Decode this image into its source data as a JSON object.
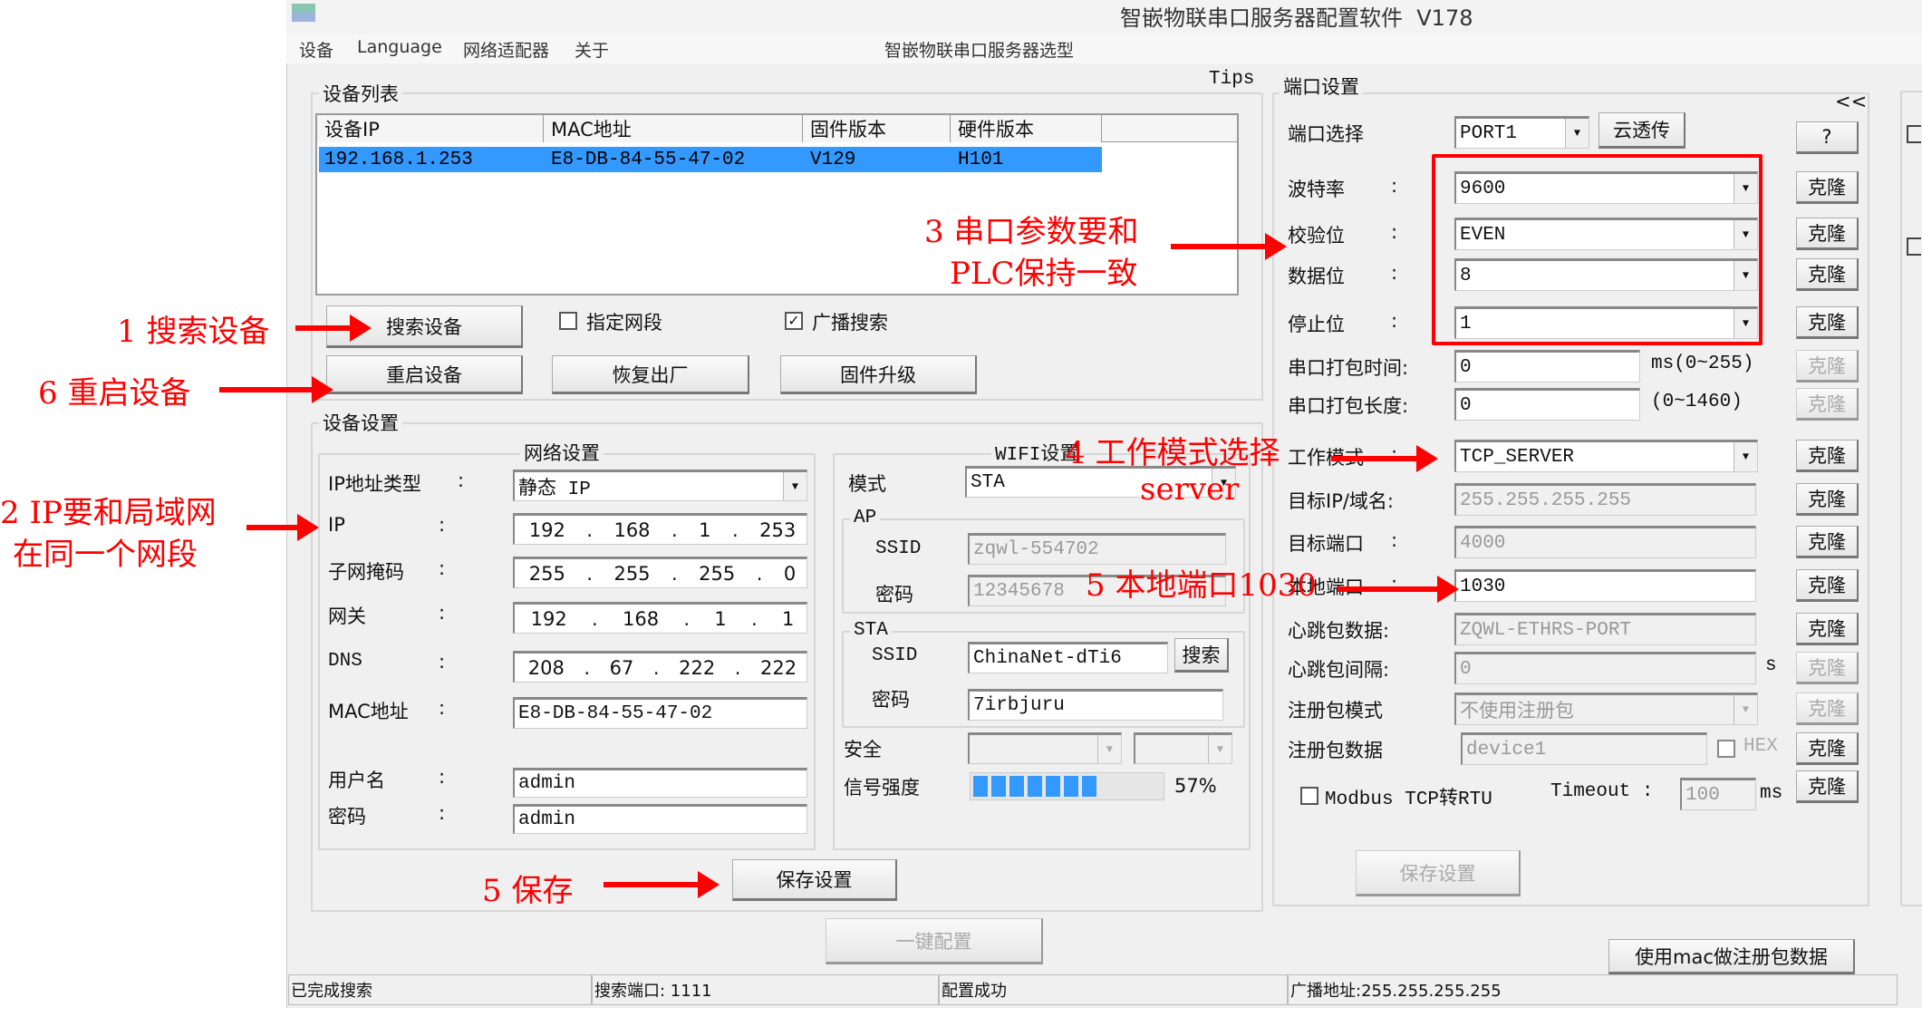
{
  "window": {
    "title": "智嵌物联串口服务器配置软件  V178",
    "model_link": "智嵌物联串口服务器选型",
    "tips": "Tips"
  },
  "menu": [
    "设备",
    "Language",
    "网络适配器",
    "关于"
  ],
  "device_list": {
    "title": "设备列表",
    "columns": [
      "设备IP",
      "MAC地址",
      "固件版本",
      "硬件版本"
    ],
    "rows": [
      [
        "192.168.1.253",
        "E8-DB-84-55-47-02",
        "V129",
        "H101"
      ]
    ]
  },
  "search": {
    "search_btn": "搜索设备",
    "specify_segment": "指定网段",
    "specify_checked": false,
    "broadcast": "广播搜索",
    "broadcast_checked": true,
    "reboot_btn": "重启设备",
    "factory_btn": "恢复出厂",
    "firmware_btn": "固件升级"
  },
  "device_settings": {
    "title": "设备设置",
    "network": {
      "title": "网络设置",
      "ip_type_label": "IP地址类型",
      "ip_type": "静态 IP",
      "ip_label": "IP",
      "ip": [
        "192",
        "168",
        "1",
        "253"
      ],
      "mask_label": "子网掩码",
      "mask": [
        "255",
        "255",
        "255",
        "0"
      ],
      "gw_label": "网关",
      "gw": [
        "192",
        "168",
        "1",
        "1"
      ],
      "dns_label": "DNS",
      "dns": [
        "208",
        "67",
        "222",
        "222"
      ],
      "mac_label": "MAC地址",
      "mac": "E8-DB-84-55-47-02",
      "user_label": "用户名",
      "user": "admin",
      "pwd_label": "密码",
      "pwd": "admin",
      "colon": ":"
    },
    "wifi": {
      "title": "WIFI设置",
      "mode_label": "模式",
      "mode": "STA",
      "ap_title": "AP",
      "ap_ssid_label": "SSID",
      "ap_ssid": "zqwl-554702",
      "ap_pwd_label": "密码",
      "ap_pwd": "12345678",
      "sta_title": "STA",
      "sta_ssid_label": "SSID",
      "sta_ssid": "ChinaNet-dTi6",
      "sta_search": "搜索",
      "sta_pwd_label": "密码",
      "sta_pwd": "7irbjuru",
      "security_label": "安全",
      "signal_label": "信号强度",
      "signal_percent": 57,
      "signal_text": "57%"
    },
    "save_btn": "保存设置"
  },
  "port_settings": {
    "title": "端口设置",
    "collapse": "<<",
    "help": "?",
    "port_label": "端口选择",
    "port": "PORT1",
    "cloud_btn": "云透传",
    "clone": "克隆",
    "rows": [
      {
        "label": "波特率",
        "colon": ":",
        "value": "9600",
        "type": "select"
      },
      {
        "label": "校验位",
        "colon": ":",
        "value": "EVEN",
        "type": "select"
      },
      {
        "label": "数据位",
        "colon": ":",
        "value": "8",
        "type": "select"
      },
      {
        "label": "停止位",
        "colon": ":",
        "value": "1",
        "type": "select"
      },
      {
        "label": "串口打包时间:",
        "value": "0",
        "type": "input",
        "suffix": "ms(0~255)",
        "clone_disabled": true
      },
      {
        "label": "串口打包长度:",
        "value": "0",
        "type": "input",
        "suffix": "(0~1460)",
        "clone_disabled": true
      },
      {
        "label": "工作模式",
        "colon": ":",
        "value": "TCP_SERVER",
        "type": "select"
      },
      {
        "label": "目标IP/域名:",
        "value": "255.255.255.255",
        "type": "input",
        "disabled": true
      },
      {
        "label": "目标端口",
        "colon": ":",
        "value": "4000",
        "type": "input",
        "disabled": true
      },
      {
        "label": "本地端口",
        "colon": ":",
        "value": "1030",
        "type": "input"
      },
      {
        "label": "心跳包数据:",
        "value": "ZQWL-ETHRS-PORT",
        "type": "input",
        "disabled": true
      },
      {
        "label": "心跳包间隔:",
        "value": "0",
        "type": "input",
        "disabled": true,
        "suffix": "s",
        "clone_disabled": true
      },
      {
        "label": "注册包模式",
        "value": "不使用注册包",
        "type": "select",
        "disabled": true,
        "clone_disabled": true
      },
      {
        "label": "注册包数据",
        "value": "device1",
        "type": "input",
        "disabled": true,
        "hex": "HEX"
      }
    ],
    "modbus_label": "Modbus TCP转RTU",
    "timeout_label": "Timeout :",
    "timeout": "100",
    "timeout_unit": "ms",
    "save_btn": "保存设置"
  },
  "one_key_btn": "一键配置",
  "mac_reg_btn": "使用mac做注册包数据",
  "status": [
    "已完成搜索",
    "搜索端口: 1111",
    "配置成功",
    "广播地址:255.255.255.255"
  ],
  "annotations": {
    "a1": "1 搜索设备",
    "a6": "6 重启设备",
    "a2_1": "2 IP要和局域网",
    "a2_2": "在同一个网段",
    "a3_1": "3 串口参数要和",
    "a3_2": "PLC保持一致",
    "a4": "4 工作模式选择",
    "a4_2": "server",
    "a5_port": "5 本地端口1030",
    "a5_save": "5 保存"
  },
  "colors": {
    "selection": "#3399ff",
    "annotation": "#ff0000",
    "signal": "#3399ff"
  }
}
